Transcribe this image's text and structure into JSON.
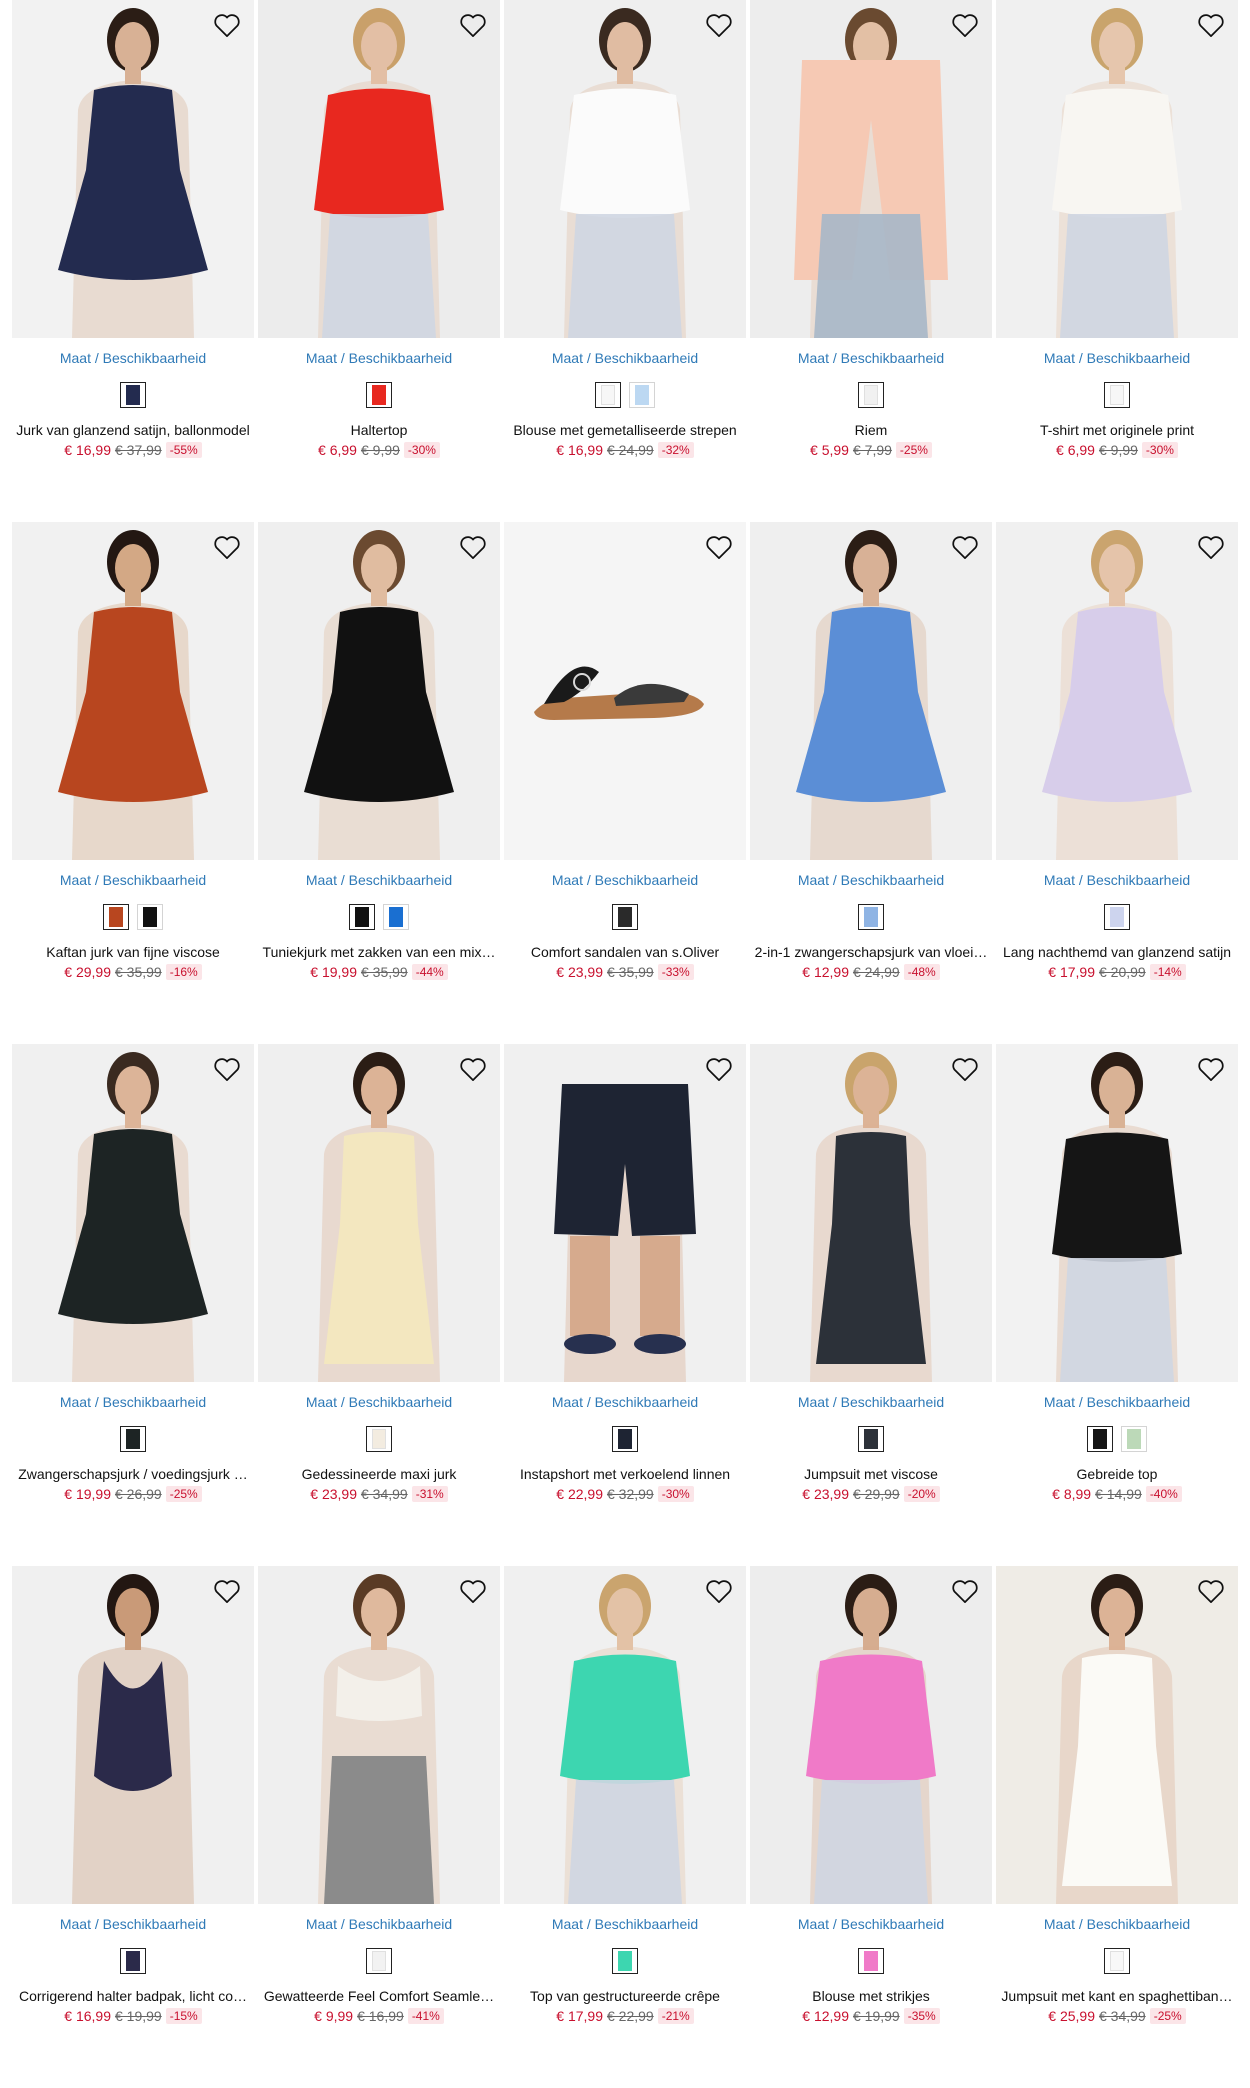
{
  "wishlist_icon": "heart-outline-icon",
  "products": [
    {
      "size_link": "Maat / Beschikbaarheid",
      "title": "Jurk van glanzend satijn, ballonmodel",
      "price": "€ 16,99",
      "old_price": "€ 37,99",
      "discount": "-55%",
      "bg": "#f2f2f2",
      "garment": "#232b4f",
      "skin": "#d8b195",
      "hair": "#2b1d15",
      "shape": "dress",
      "swatches": [
        "#232b4f"
      ]
    },
    {
      "size_link": "Maat / Beschikbaarheid",
      "title": "Haltertop",
      "price": "€ 6,99",
      "old_price": "€ 9,99",
      "discount": "-30%",
      "bg": "#ececec",
      "garment": "#e8281f",
      "skin": "#e3bfa5",
      "hair": "#c9a06a",
      "shape": "top",
      "swatches": [
        "#e8281f"
      ]
    },
    {
      "size_link": "Maat / Beschikbaarheid",
      "title": "Blouse met gemetalliseerde strepen",
      "price": "€ 16,99",
      "old_price": "€ 24,99",
      "discount": "-32%",
      "bg": "#efefef",
      "garment": "#fbfbfb",
      "skin": "#e0bca2",
      "hair": "#3a2a20",
      "shape": "top",
      "swatches": [
        "#f7f7f7",
        "#bcd8f2"
      ]
    },
    {
      "size_link": "Maat / Beschikbaarheid",
      "title": "Riem",
      "price": "€ 5,99",
      "old_price": "€ 7,99",
      "discount": "-25%",
      "bg": "#ededed",
      "garment": "#f6c9b4",
      "skin": "#e3c0a5",
      "hair": "#6a4a30",
      "shape": "coat",
      "swatches": [
        "#f1f1f1"
      ]
    },
    {
      "size_link": "Maat / Beschikbaarheid",
      "title": "T-shirt met originele print",
      "price": "€ 6,99",
      "old_price": "€ 9,99",
      "discount": "-30%",
      "bg": "#f0f0f0",
      "garment": "#f8f6f2",
      "skin": "#e6c6ad",
      "hair": "#c9a46c",
      "shape": "top",
      "swatches": [
        "#f7f7f7"
      ]
    },
    {
      "size_link": "Maat / Beschikbaarheid",
      "title": "Kaftan jurk van fijne viscose",
      "price": "€ 29,99",
      "old_price": "€ 35,99",
      "discount": "-16%",
      "bg": "#f1f1f1",
      "garment": "#b8461f",
      "skin": "#d3a885",
      "hair": "#231712",
      "shape": "dress",
      "swatches": [
        "#b8461f",
        "#111111"
      ]
    },
    {
      "size_link": "Maat / Beschikbaarheid",
      "title": "Tuniekjurk met zakken van een mix…",
      "price": "€ 19,99",
      "old_price": "€ 35,99",
      "discount": "-44%",
      "bg": "#efefef",
      "garment": "#111111",
      "skin": "#e0bca0",
      "hair": "#6b4a30",
      "shape": "dress",
      "swatches": [
        "#111111",
        "#1a6fd1"
      ]
    },
    {
      "size_link": "Maat / Beschikbaarheid",
      "title": "Comfort sandalen van s.Oliver",
      "price": "€ 23,99",
      "old_price": "€ 35,99",
      "discount": "-33%",
      "bg": "#f5f5f5",
      "garment": "#1a1a1a",
      "skin": "#f5f5f5",
      "hair": "#f5f5f5",
      "shape": "shoe",
      "swatches": [
        "#2a2a2a"
      ]
    },
    {
      "size_link": "Maat / Beschikbaarheid",
      "title": "2-in-1 zwangerschapsjurk van vloei…",
      "price": "€ 12,99",
      "old_price": "€ 24,99",
      "discount": "-48%",
      "bg": "#efefef",
      "garment": "#5b8ed6",
      "skin": "#d8b196",
      "hair": "#2b1d15",
      "shape": "dress",
      "swatches": [
        "#8fb4e4"
      ]
    },
    {
      "size_link": "Maat / Beschikbaarheid",
      "title": "Lang nachthemd van glanzend satijn",
      "price": "€ 17,99",
      "old_price": "€ 20,99",
      "discount": "-14%",
      "bg": "#f0f0f0",
      "garment": "#d7cdea",
      "skin": "#e5c4aa",
      "hair": "#caa46e",
      "shape": "dress",
      "swatches": [
        "#cdd4ee"
      ]
    },
    {
      "size_link": "Maat / Beschikbaarheid",
      "title": "Zwangerschapsjurk / voedingsjurk …",
      "price": "€ 19,99",
      "old_price": "€ 26,99",
      "discount": "-25%",
      "bg": "#f0f0f0",
      "garment": "#1d2424",
      "skin": "#dcb498",
      "hair": "#3a2a20",
      "shape": "dress",
      "swatches": [
        "#1d2424"
      ]
    },
    {
      "size_link": "Maat / Beschikbaarheid",
      "title": "Gedessineerde maxi jurk",
      "price": "€ 23,99",
      "old_price": "€ 34,99",
      "discount": "-31%",
      "bg": "#efefef",
      "garment": "#f3e7bf",
      "skin": "#dcb396",
      "hair": "#2b1d15",
      "shape": "long",
      "swatches": [
        "#f3ece0"
      ]
    },
    {
      "size_link": "Maat / Beschikbaarheid",
      "title": "Instapshort met verkoelend linnen",
      "price": "€ 22,99",
      "old_price": "€ 32,99",
      "discount": "-30%",
      "bg": "#f0f0f0",
      "garment": "#1e2433",
      "skin": "#d6aa8d",
      "hair": "#f0f0f0",
      "shape": "shorts",
      "swatches": [
        "#1e2433"
      ]
    },
    {
      "size_link": "Maat / Beschikbaarheid",
      "title": "Jumpsuit met viscose",
      "price": "€ 23,99",
      "old_price": "€ 29,99",
      "discount": "-20%",
      "bg": "#eeeeee",
      "garment": "#2c3139",
      "skin": "#dcb396",
      "hair": "#c9a46c",
      "shape": "long",
      "swatches": [
        "#2c3139"
      ]
    },
    {
      "size_link": "Maat / Beschikbaarheid",
      "title": "Gebreide top",
      "price": "€ 8,99",
      "old_price": "€ 14,99",
      "discount": "-40%",
      "bg": "#f2f2f2",
      "garment": "#151515",
      "skin": "#d9b295",
      "hair": "#2b1d15",
      "shape": "top",
      "swatches": [
        "#151515",
        "#bcd9b8"
      ]
    },
    {
      "size_link": "Maat / Beschikbaarheid",
      "title": "Corrigerend halter badpak, licht co…",
      "price": "€ 16,99",
      "old_price": "€ 19,99",
      "discount": "-15%",
      "bg": "#f0f0f0",
      "garment": "#2b2a4a",
      "skin": "#c99a78",
      "hair": "#231712",
      "shape": "swim",
      "swatches": [
        "#2b2a4a"
      ]
    },
    {
      "size_link": "Maat / Beschikbaarheid",
      "title": "Gewatteerde Feel Comfort Seamle…",
      "price": "€ 9,99",
      "old_price": "€ 16,99",
      "discount": "-41%",
      "bg": "#efefef",
      "garment": "#f3f0ea",
      "skin": "#dfb99d",
      "hair": "#5a3b25",
      "shape": "bra",
      "swatches": [
        "#f2f2f2"
      ]
    },
    {
      "size_link": "Maat / Beschikbaarheid",
      "title": "Top van gestructureerde crêpe",
      "price": "€ 17,99",
      "old_price": "€ 22,99",
      "discount": "-21%",
      "bg": "#f0f0f0",
      "garment": "#3dd6b0",
      "skin": "#e3c2a6",
      "hair": "#caa46e",
      "shape": "top",
      "swatches": [
        "#3dd6b0"
      ]
    },
    {
      "size_link": "Maat / Beschikbaarheid",
      "title": "Blouse met strikjes",
      "price": "€ 12,99",
      "old_price": "€ 19,99",
      "discount": "-35%",
      "bg": "#ededed",
      "garment": "#f07ac8",
      "skin": "#d6ad90",
      "hair": "#2b1d15",
      "shape": "top",
      "swatches": [
        "#f07ac8"
      ]
    },
    {
      "size_link": "Maat / Beschikbaarheid",
      "title": "Jumpsuit met kant en spaghettiban…",
      "price": "€ 25,99",
      "old_price": "€ 34,99",
      "discount": "-25%",
      "bg": "#efece6",
      "garment": "#fbfaf6",
      "skin": "#dcb396",
      "hair": "#2b1d15",
      "shape": "long",
      "swatches": [
        "#f8f8f8"
      ]
    }
  ]
}
